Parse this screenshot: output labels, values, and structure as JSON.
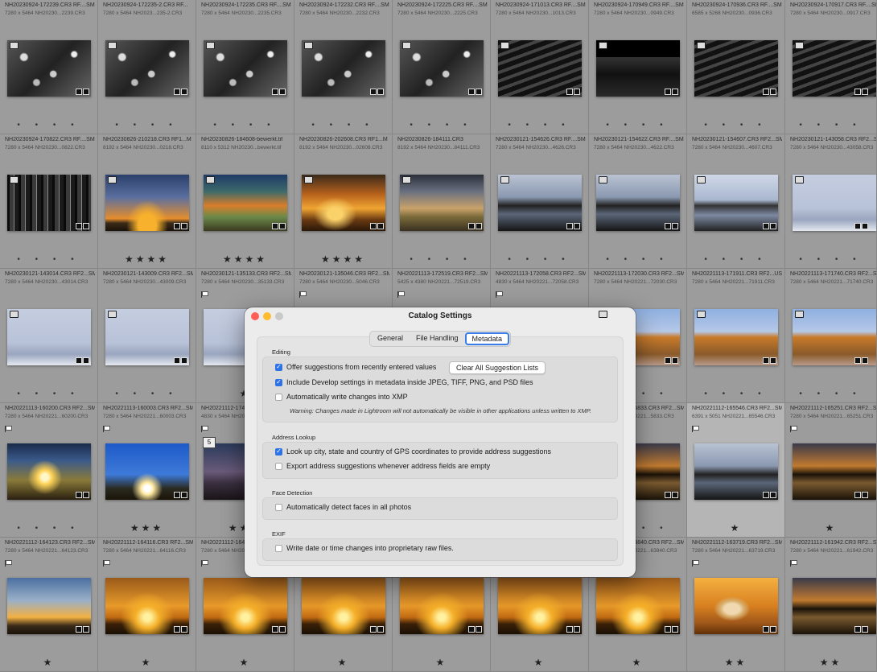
{
  "grid": {
    "rows": [
      [
        {
          "fn": "NH20230924-172239.CR3   RF....SM",
          "dim": "7280 x 5464    NH20230...2239.CR3",
          "t": "t-bw1",
          "dots": "• • • •"
        },
        {
          "fn": "NH20230924-172235-2.CR3   RF...",
          "dim": "7280 x 5464    NH2023...235-2.CR3",
          "t": "t-bw1",
          "dots": "• • • •"
        },
        {
          "fn": "NH20230924-172235.CR3   RF....SM",
          "dim": "7280 x 5464    NH20230...2235.CR3",
          "t": "t-bw1",
          "dots": "• • • •"
        },
        {
          "fn": "NH20230924-172232.CR3   RF....SM",
          "dim": "7280 x 5464    NH20230...2232.CR3",
          "t": "t-bw1",
          "dots": "• • • •"
        },
        {
          "fn": "NH20230924-172225.CR3   RF....SM",
          "dim": "7280 x 5464    NH20230...2225.CR3",
          "t": "t-bw1",
          "dots": "• • • •"
        },
        {
          "fn": "NH20230924-171013.CR3   RF....SM",
          "dim": "7280 x 5464    NH20230...1013.CR3",
          "t": "t-bw2",
          "dots": "• • • •"
        },
        {
          "fn": "NH20230924-170949.CR3   RF....SM",
          "dim": "7280 x 5464    NH20230...0949.CR3",
          "t": "t-bw3",
          "dots": "• • • •"
        },
        {
          "fn": "NH20230924-170936.CR3   RF....SM",
          "dim": "6585 x 5268    NH20230...0936.CR3",
          "t": "t-bw2",
          "dots": "• • • •"
        },
        {
          "fn": "NH20230924-170917.CR3   RF....SM",
          "dim": "7280 x 5464    NH20230...0917.CR3",
          "t": "t-bw2",
          "dots": "• • • •"
        }
      ],
      [
        {
          "fn": "NH20230924-170822.CR3   RF....SM",
          "dim": "7280 x 5464    NH20230...0822.CR3",
          "t": "t-bwf",
          "dots": "• • • •"
        },
        {
          "fn": "NH20230826-210218.CR3   RF1...M",
          "dim": "8192 x 5464    NH20230...0218.CR3",
          "t": "t-sunset-tree",
          "stars": "★★★★"
        },
        {
          "fn": "NH20230826-184608-bewerkt.tif",
          "dim": "8110 x 5312    NH20230...bewerkt.tif",
          "t": "t-sky-color",
          "stars": "★★★★"
        },
        {
          "fn": "NH20230826-202608.CR3   RF1...M",
          "dim": "8192 x 5464    NH20230...02608.CR3",
          "t": "t-gold",
          "stars": "★★★★"
        },
        {
          "fn": "NH20230826-184111.CR3",
          "dim": "8192 x 5464    NH20230...84111.CR3",
          "t": "t-dramatic",
          "dots": "• • • •"
        },
        {
          "fn": "NH20230121-154626.CR3   RF....SM",
          "dim": "7280 x 5464    NH20230...4626.CR3",
          "t": "t-lake",
          "dots": "• • • •"
        },
        {
          "fn": "NH20230121-154622.CR3   RF....SM",
          "dim": "7280 x 5464    NH20230...4622.CR3",
          "t": "t-lake",
          "dots": "• • • •"
        },
        {
          "fn": "NH20230121-154607.CR3   RF2...SM",
          "dim": "7280 x 5464    NH20230...4607.CR3",
          "t": "t-lake2",
          "dots": "• • • •"
        },
        {
          "fn": "NH20230121-143058.CR3   RF2...SM",
          "dim": "7280 x 5464    NH20230...43058.CR3",
          "t": "t-winter",
          "dots": "• • • •"
        }
      ],
      [
        {
          "fn": "NH20230121-143014.CR3   RF2...SM",
          "dim": "7280 x 5464    NH20230...43014.CR3",
          "t": "t-winter",
          "dots": "• • • •"
        },
        {
          "fn": "NH20230121-143009.CR3   RF2...SM",
          "dim": "7280 x 5464    NH20230...43009.CR3",
          "t": "t-winter",
          "dots": "• • • •"
        },
        {
          "fn": "NH20230121-135133.CR3   RF2...SM",
          "dim": "7280 x 5464    NH20230...35133.CR3",
          "t": "t-winter",
          "stars": "★"
        },
        {
          "fn": "NH20230121-135046.CR3   RF2...SM",
          "dim": "7280 x 5464    NH20230...5046.CR3",
          "t": "t-winter",
          "dots": "• • • •"
        },
        {
          "fn": "NH20221113-172519.CR3   RF2...SM",
          "dim": "5425 x 4380    NH20221...72519.CR3",
          "t": "t-autumn",
          "dots": "• • • •"
        },
        {
          "fn": "NH20221113-172058.CR3   RF2...SM",
          "dim": "4830 x 5464    NH20221...72058.CR3",
          "t": "t-autumn",
          "dots": "• • • •"
        },
        {
          "fn": "NH20221113-172030.CR3   RF2...SM",
          "dim": "7280 x 5464    NH20221...72030.CR3",
          "t": "t-autumn",
          "dots": "• • • •"
        },
        {
          "fn": "NH20221113-171911.CR3   RF2...USM",
          "dim": "7280 x 5464    NH20221...71911.CR3",
          "t": "t-autumn",
          "dots": "• • • •"
        },
        {
          "fn": "NH20221113-171740.CR3   RF2...SM",
          "dim": "7280 x 5464    NH20221...71740.CR3",
          "t": "t-autumn",
          "dots": "• • • •"
        }
      ],
      [
        {
          "fn": "NH20221113-160200.CR3   RF2...SM",
          "dim": "7280 x 5464    NH20221...60200.CR3",
          "t": "t-sunrise-tree",
          "dots": "• • • •"
        },
        {
          "fn": "NH20221113-160003.CR3   RF2...SM",
          "dim": "7280 x 5464    NH20221...60003.CR3",
          "t": "t-blue-sun",
          "stars": "★★★"
        },
        {
          "fn": "NH20221112-17414...",
          "dim": "4830 x 5464    NH20221...",
          "t": "t-dusk",
          "stars": "★★★"
        },
        {
          "fn": "",
          "dim": "",
          "t": "t-dusk",
          "dots": ""
        },
        {
          "fn": "",
          "dim": "",
          "t": "t-golden-lake",
          "dots": ""
        },
        {
          "fn": "",
          "dim": "",
          "t": "t-golden-lake",
          "dots": ""
        },
        {
          "fn": "NH20221112-165833.CR3   RF2...SM",
          "dim": "7280 x 5464    NH20221...5833.CR3",
          "t": "t-golden-lake",
          "dots": "• • • •"
        },
        {
          "fn": "NH20221112-165546.CR3   RF2...SM",
          "dim": "6391 x 5051    NH20221...65546.CR3",
          "t": "t-lake",
          "stars": "★"
        },
        {
          "fn": "NH20221112-165251.CR3   RF2...SM",
          "dim": "7280 x 5464    NH20221...65251.CR3",
          "t": "t-golden-lake",
          "stars": "★"
        }
      ],
      [
        {
          "fn": "NH20221112-164123.CR3   RF2...SM",
          "dim": "7280 x 5464    NH20221...64123.CR3",
          "t": "t-sunset-sky",
          "stars": "★"
        },
        {
          "fn": "NH20221112-164116.CR3   RF2...SM",
          "dim": "7280 x 5464    NH20221...64116.CR3",
          "t": "t-orange",
          "stars": "★"
        },
        {
          "fn": "NH20221112-1641...",
          "dim": "7280 x 5464    NH20221...",
          "t": "t-orange",
          "stars": "★"
        },
        {
          "fn": "",
          "dim": "",
          "t": "t-orange",
          "stars": "★"
        },
        {
          "fn": "",
          "dim": "",
          "t": "t-orange",
          "stars": "★"
        },
        {
          "fn": "",
          "dim": "",
          "t": "t-orange",
          "stars": "★"
        },
        {
          "fn": "NH20221112-163840.CR3   RF2...SM",
          "dim": "7280 x 5464    NH20221...63840.CR3",
          "t": "t-orange",
          "stars": "★"
        },
        {
          "fn": "NH20221112-163719.CR3   RF2...SM",
          "dim": "7280 x 5464    NH20221...63719.CR3",
          "t": "t-dog",
          "stars": "★★"
        },
        {
          "fn": "NH20221112-161942.CR3   RF2...SM",
          "dim": "7280 x 5464    NH20221...61942.CR3",
          "t": "t-golden-lake",
          "stars": "★★"
        }
      ]
    ],
    "badge_number": "5"
  },
  "dialog": {
    "title": "Catalog Settings",
    "tabs": [
      "General",
      "File Handling",
      "Metadata"
    ],
    "active_tab": "Metadata",
    "sections": {
      "editing": "Editing",
      "address": "Address Lookup",
      "face": "Face Detection",
      "exif": "EXIF"
    },
    "options": {
      "offer_suggestions": "Offer suggestions from recently entered values",
      "include_develop": "Include Develop settings in metadata inside JPEG, TIFF, PNG, and PSD files",
      "auto_write_xmp": "Automatically write changes into XMP",
      "warning": "Warning: Changes made in Lightroom will not automatically be visible in other applications unless written to XMP.",
      "lookup_gps": "Look up city, state and country of GPS coordinates to provide address suggestions",
      "export_address": "Export address suggestions whenever address fields are empty",
      "detect_faces": "Automatically detect faces in all photos",
      "write_date": "Write date or time changes into proprietary raw files."
    },
    "clear_button": "Clear All Suggestion Lists",
    "checked": {
      "offer_suggestions": true,
      "include_develop": true,
      "auto_write_xmp": false,
      "lookup_gps": true,
      "export_address": false,
      "detect_faces": false,
      "write_date": false
    },
    "accent_color": "#2d72e6"
  }
}
